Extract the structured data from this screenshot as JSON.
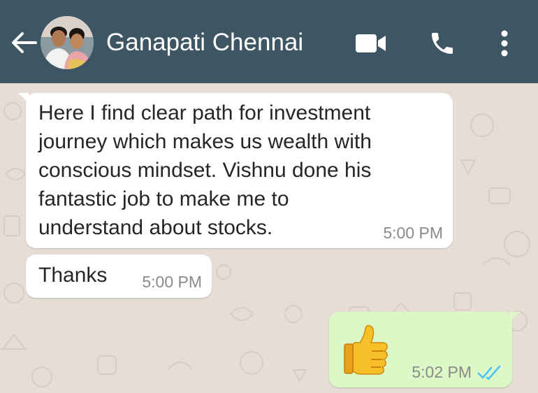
{
  "header": {
    "contact_name": "Ganapati Chennai",
    "background_color": "#3e5663",
    "icons": [
      "back-arrow-icon",
      "video-call-icon",
      "phone-icon",
      "more-options-icon"
    ]
  },
  "messages": [
    {
      "direction": "incoming",
      "lines": [
        "Here I find clear path for investment",
        "journey which makes us wealth with",
        "conscious mindset. Vishnu done his",
        "fantastic job to make me to",
        "understand about stocks."
      ],
      "time": "5:00 PM"
    },
    {
      "direction": "incoming",
      "text": "Thanks",
      "time": "5:00 PM"
    },
    {
      "direction": "outgoing",
      "emoji": "👍",
      "time": "5:02 PM",
      "status": "read",
      "status_icon": "double-check-icon",
      "status_color": "#4fc3f7"
    }
  ],
  "colors": {
    "chat_background": "#e6ded5",
    "incoming_bubble": "#ffffff",
    "outgoing_bubble": "#dcf8c6"
  }
}
